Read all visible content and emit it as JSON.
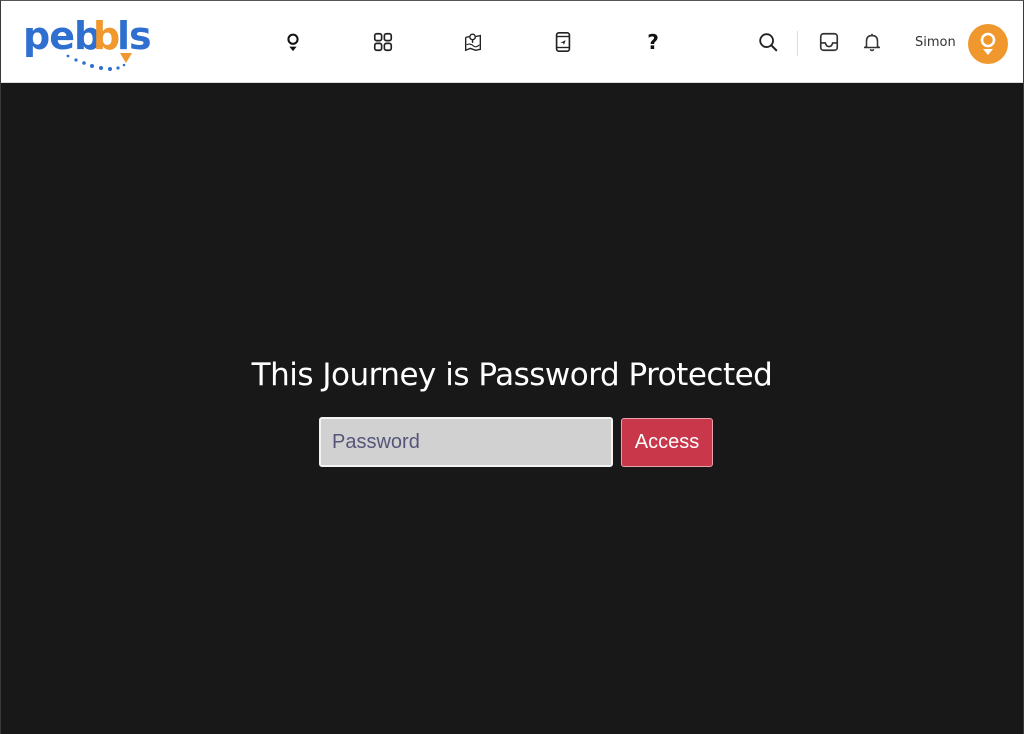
{
  "header": {
    "logo_text": "pebbls",
    "brand_colors": {
      "blue": "#2e6fcf",
      "orange": "#f0982d"
    },
    "nav_icons": [
      {
        "name": "pin-icon",
        "label": "Pebbles"
      },
      {
        "name": "grid-icon",
        "label": "Dashboard"
      },
      {
        "name": "map-icon",
        "label": "Journeys"
      },
      {
        "name": "mobile-icon",
        "label": "App"
      },
      {
        "name": "help-icon",
        "label": "?"
      }
    ],
    "help_glyph": "?",
    "user_name": "Simon",
    "avatar_color": "#f0982d"
  },
  "main": {
    "title": "This Journey is Password Protected",
    "password_placeholder": "Password",
    "password_value": "",
    "access_label": "Access",
    "access_color": "#c8374a",
    "background": "#181818"
  }
}
